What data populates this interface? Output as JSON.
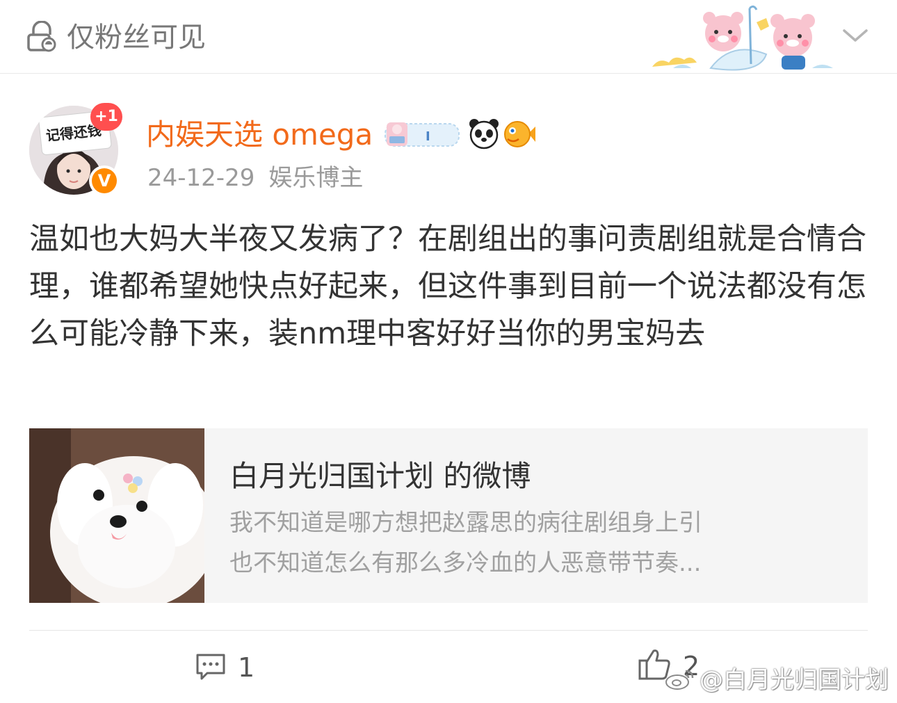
{
  "header": {
    "visibility": "仅粉丝可见"
  },
  "author": {
    "name": "内娱天选 omega",
    "plus_badge": "+1",
    "avatar_sign": "记得还钱",
    "verified_mark": "V",
    "date": "24-12-29",
    "category": "娱乐博主",
    "badge_strip_char": "I"
  },
  "post": {
    "text": "温如也大妈大半夜又发病了？在剧组出的事问责剧组就是合情合理，谁都希望她快点好起来，但这件事到目前一个说法都没有怎么可能冷静下来，装nm理中客好好当你的男宝妈去"
  },
  "repost": {
    "title": "白月光归国计划 的微博",
    "line1": "我不知道是哪方想把赵露思的病往剧组身上引",
    "line2": "也不知道怎么有那么多冷血的人恶意带节奏..."
  },
  "footer": {
    "comment_count": "1",
    "like_count": "2",
    "watermark": "@白月光归国计划"
  },
  "colors": {
    "author_name": "#f26a1b",
    "verified": "#ff8a00",
    "plus_badge": "#ff4f4f",
    "card_bg": "#f5f5f5"
  }
}
